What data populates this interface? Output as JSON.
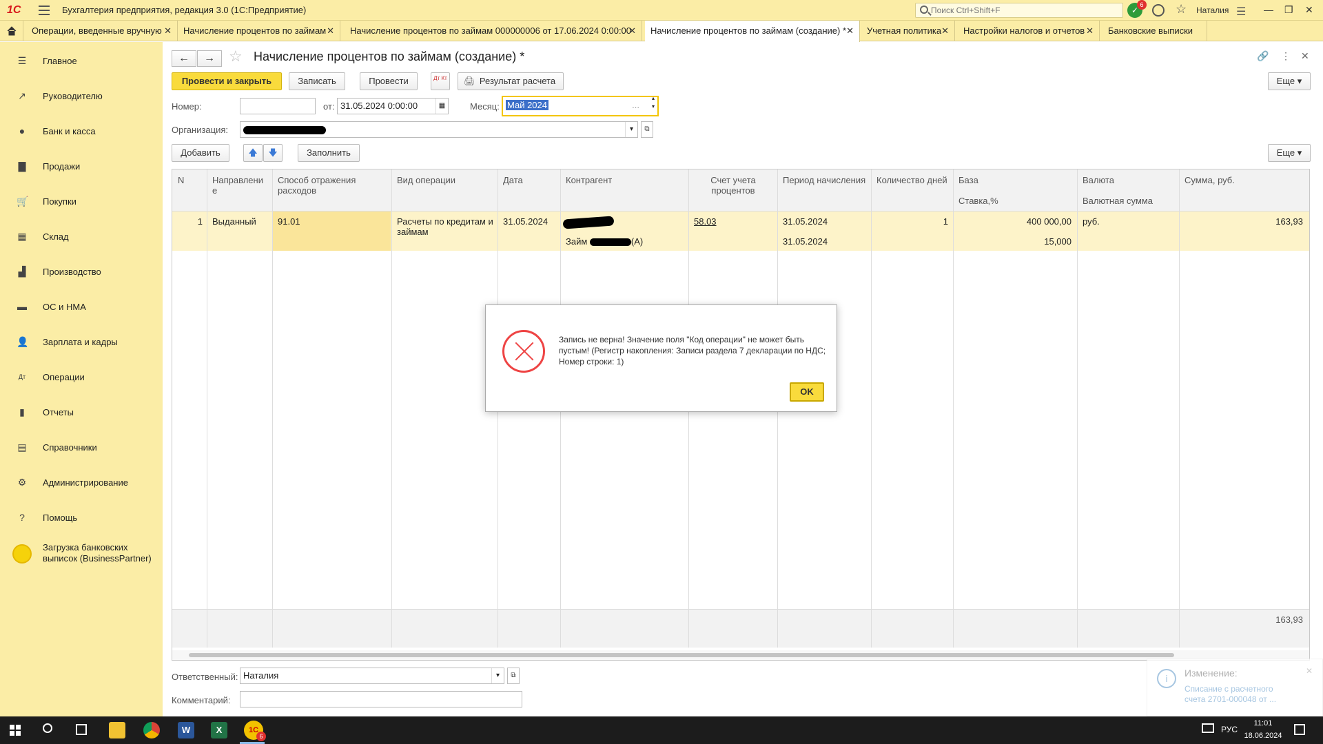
{
  "app": {
    "logo": "1С",
    "title": "Бухгалтерия предприятия, редакция 3.0  (1С:Предприятие)",
    "search_placeholder": "Поиск Ctrl+Shift+F",
    "notif_count": "6",
    "user": "Наталия"
  },
  "tabs": [
    {
      "label": "Операции, введенные вручную"
    },
    {
      "label": "Начисление процентов по займам"
    },
    {
      "label": "Начисление процентов по займам 000000006 от 17.06.2024 0:00:00"
    },
    {
      "label": "Начисление процентов по займам (создание) *"
    },
    {
      "label": "Учетная политика"
    },
    {
      "label": "Настройки налогов и отчетов"
    },
    {
      "label": "Банковские выписки"
    }
  ],
  "sidebar": {
    "items": [
      {
        "label": "Главное",
        "icon": "menu-icon"
      },
      {
        "label": "Руководителю",
        "icon": "trend-icon"
      },
      {
        "label": "Банк и касса",
        "icon": "bank-icon"
      },
      {
        "label": "Продажи",
        "icon": "bag-icon"
      },
      {
        "label": "Покупки",
        "icon": "cart-icon"
      },
      {
        "label": "Склад",
        "icon": "warehouse-icon"
      },
      {
        "label": "Производство",
        "icon": "factory-icon"
      },
      {
        "label": "ОС и НМА",
        "icon": "truck-icon"
      },
      {
        "label": "Зарплата и кадры",
        "icon": "person-icon"
      },
      {
        "label": "Операции",
        "icon": "operations-icon"
      },
      {
        "label": "Отчеты",
        "icon": "chart-icon"
      },
      {
        "label": "Справочники",
        "icon": "book-icon"
      },
      {
        "label": "Администрирование",
        "icon": "gear-icon"
      },
      {
        "label": "Помощь",
        "icon": "help-icon"
      },
      {
        "label": "Загрузка банковских выписок (BusinessPartner)",
        "icon": "circle-icon"
      }
    ]
  },
  "form": {
    "title": "Начисление процентов по займам (создание) *",
    "buttons": {
      "post_close": "Провести и закрыть",
      "save": "Записать",
      "post": "Провести",
      "dtkt": "Дт Кт",
      "result": "Результат расчета",
      "more": "Еще",
      "add": "Добавить",
      "fill": "Заполнить",
      "more2": "Еще"
    },
    "number_label": "Номер:",
    "number_value": "",
    "date_label": "от:",
    "date_value": "31.05.2024  0:00:00",
    "month_label": "Месяц:",
    "month_value": "Май 2024",
    "org_label": "Организация:",
    "responsible_label": "Ответственный:",
    "responsible_value": "Наталия",
    "comment_label": "Комментарий:",
    "comment_value": ""
  },
  "table": {
    "headers": {
      "n": "N",
      "direction": "Направлени е",
      "method": "Способ отражения расходов",
      "op_type": "Вид операции",
      "date": "Дата",
      "counterparty": "Контрагент",
      "account": "Счет учета процентов",
      "period": "Период начисления",
      "days": "Количество дней",
      "base": "База",
      "rate": "Ставка,%",
      "currency": "Валюта",
      "cur_amount": "Валютная сумма",
      "sum": "Сумма, руб."
    },
    "row": {
      "n": "1",
      "direction": "Выданный",
      "method": "91.01",
      "op_type": "Расчеты по кредитам и займам",
      "date": "31.05.2024",
      "loan": "Займ",
      "loan_suffix": "(А)",
      "account": "58.03",
      "period1": "31.05.2024",
      "period2": "31.05.2024",
      "days": "1",
      "base": "400 000,00",
      "rate": "15,000",
      "currency": "руб.",
      "sum": "163,93"
    },
    "total": "163,93"
  },
  "dialog": {
    "message": "Запись не верна! Значение поля \"Код операции\" не может быть пустым! (Регистр накопления: Записи раздела 7 декларации по НДС; Номер строки: 1)",
    "ok": "OK"
  },
  "toast": {
    "title": "Изменение:",
    "text": "Списание с расчетного счета 2701-000048 от ..."
  },
  "taskbar": {
    "lang": "РУС",
    "time": "11:01",
    "date": "18.06.2024",
    "app_badge": "6"
  }
}
